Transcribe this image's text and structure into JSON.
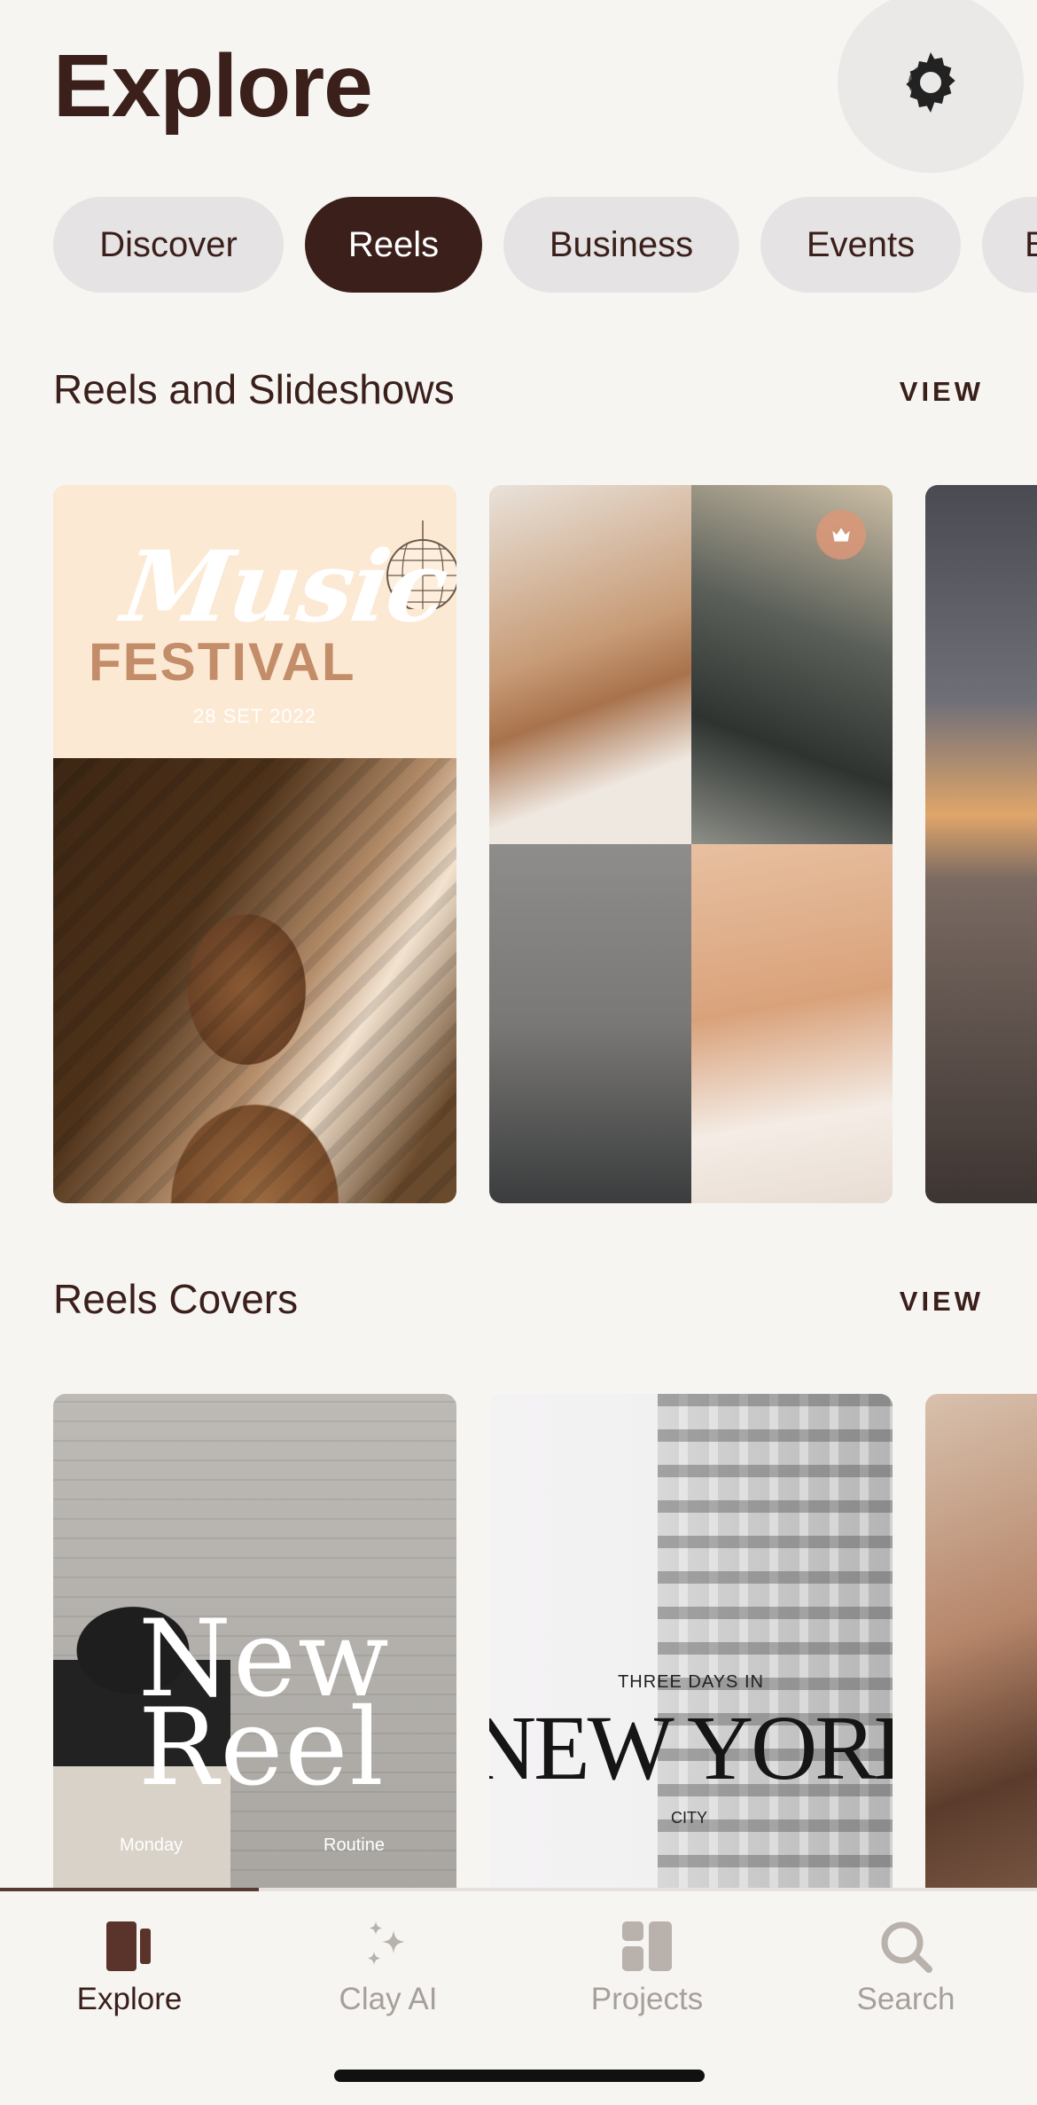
{
  "header": {
    "title": "Explore",
    "settings_icon": "gear-icon"
  },
  "chips": [
    {
      "label": "Discover",
      "active": false
    },
    {
      "label": "Reels",
      "active": true
    },
    {
      "label": "Business",
      "active": false
    },
    {
      "label": "Events",
      "active": false
    },
    {
      "label": "B",
      "active": false
    }
  ],
  "sections": [
    {
      "title": "Reels and Slideshows",
      "view_label": "VIEW",
      "cards": [
        {
          "music": "Music",
          "festival": "FESTIVAL",
          "date": "28 SET 2022"
        },
        {
          "badge_icon": "crown-icon"
        },
        {}
      ]
    },
    {
      "title": "Reels Covers",
      "view_label": "VIEW",
      "cards": [
        {
          "line1": "New",
          "line2": "Reel",
          "left": "Monday",
          "right": "Routine"
        },
        {
          "three_days": "THREE DAYS IN",
          "big": "NEW YORK",
          "city": "CITY"
        },
        {}
      ]
    }
  ],
  "tabbar": [
    {
      "label": "Explore",
      "icon": "explore-icon",
      "active": true
    },
    {
      "label": "Clay AI",
      "icon": "sparkles-icon",
      "active": false
    },
    {
      "label": "Projects",
      "icon": "projects-icon",
      "active": false
    },
    {
      "label": "Search",
      "icon": "search-icon",
      "active": false
    }
  ],
  "colors": {
    "primary": "#3a1f1a",
    "background": "#f7f5f2",
    "chip": "#e6e3e4",
    "inactive_tab": "#a79f9a"
  }
}
